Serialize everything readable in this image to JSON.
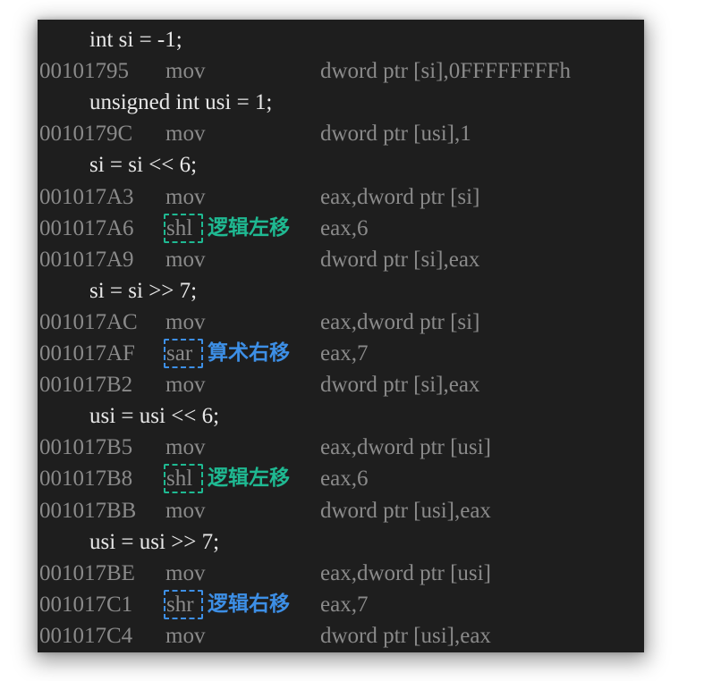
{
  "colors": {
    "background": "#1e1e1e",
    "source_text": "#e8e8e8",
    "asm_text": "#8a8a8a",
    "logical_note": "#1fb992",
    "arith_note": "#3d8fe6"
  },
  "rows": [
    {
      "kind": "src",
      "text": "int si = -1;"
    },
    {
      "kind": "asm",
      "addr": "00101795",
      "mnemonic": "mov",
      "operands": "dword ptr [si],0FFFFFFFFh"
    },
    {
      "kind": "src",
      "text": "unsigned int usi = 1;"
    },
    {
      "kind": "asm",
      "addr": "0010179C",
      "mnemonic": "mov",
      "operands": "dword ptr [usi],1"
    },
    {
      "kind": "src",
      "text": "si = si << 6;"
    },
    {
      "kind": "asm",
      "addr": "001017A3",
      "mnemonic": "mov",
      "operands": "eax,dword ptr [si]"
    },
    {
      "kind": "asm",
      "addr": "001017A6",
      "mnemonic": "shl",
      "operands": "eax,6",
      "note": "逻辑左移",
      "note_color": "green"
    },
    {
      "kind": "asm",
      "addr": "001017A9",
      "mnemonic": "mov",
      "operands": "dword ptr [si],eax"
    },
    {
      "kind": "src",
      "text": "si = si >> 7;"
    },
    {
      "kind": "asm",
      "addr": "001017AC",
      "mnemonic": "mov",
      "operands": "eax,dword ptr [si]"
    },
    {
      "kind": "asm",
      "addr": "001017AF",
      "mnemonic": "sar",
      "operands": "eax,7",
      "note": "算术右移",
      "note_color": "blue"
    },
    {
      "kind": "asm",
      "addr": "001017B2",
      "mnemonic": "mov",
      "operands": "dword ptr [si],eax"
    },
    {
      "kind": "src",
      "text": "usi = usi << 6;"
    },
    {
      "kind": "asm",
      "addr": "001017B5",
      "mnemonic": "mov",
      "operands": "eax,dword ptr [usi]"
    },
    {
      "kind": "asm",
      "addr": "001017B8",
      "mnemonic": "shl",
      "operands": "eax,6",
      "note": "逻辑左移",
      "note_color": "green"
    },
    {
      "kind": "asm",
      "addr": "001017BB",
      "mnemonic": "mov",
      "operands": "dword ptr [usi],eax"
    },
    {
      "kind": "src",
      "text": "usi = usi >> 7;"
    },
    {
      "kind": "asm",
      "addr": "001017BE",
      "mnemonic": "mov",
      "operands": "eax,dword ptr [usi]"
    },
    {
      "kind": "asm",
      "addr": "001017C1",
      "mnemonic": "shr",
      "operands": "eax,7",
      "note": "逻辑右移",
      "note_color": "blue"
    },
    {
      "kind": "asm",
      "addr": "001017C4",
      "mnemonic": "mov",
      "operands": "dword ptr [usi],eax"
    }
  ]
}
